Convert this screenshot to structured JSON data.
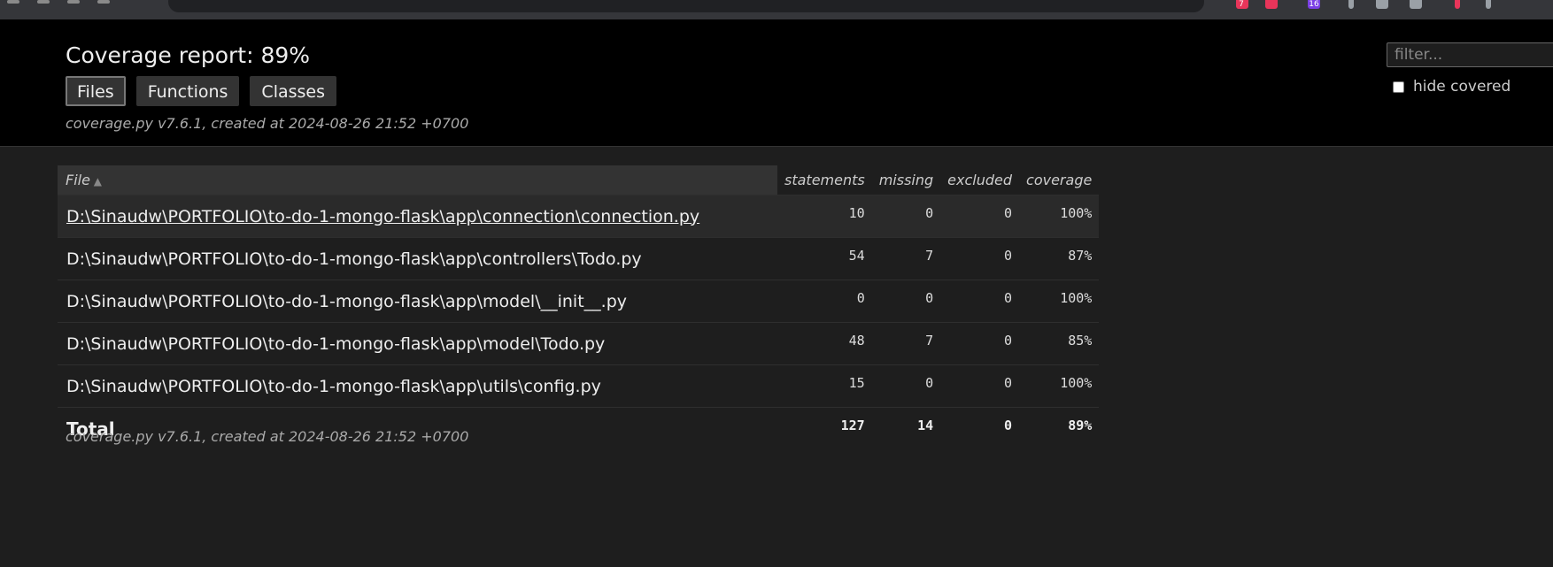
{
  "browser": {
    "extension_badges": [
      "7",
      "16"
    ]
  },
  "header": {
    "title": "Coverage report: 89%",
    "tabs": [
      {
        "label": "Files",
        "active": true
      },
      {
        "label": "Functions",
        "active": false
      },
      {
        "label": "Classes",
        "active": false
      }
    ],
    "created": "coverage.py v7.6.1, created at 2024-08-26 21:52 +0700",
    "filter_placeholder": "filter...",
    "hide_covered_label": "hide covered",
    "hide_covered_checked": false
  },
  "table": {
    "columns": [
      "File",
      "statements",
      "missing",
      "excluded",
      "coverage"
    ],
    "rows": [
      {
        "file": "D:\\Sinaudw\\PORTFOLIO\\to-do-1-mongo-flask\\app\\connection\\connection.py",
        "statements": "10",
        "missing": "0",
        "excluded": "0",
        "coverage": "100%"
      },
      {
        "file": "D:\\Sinaudw\\PORTFOLIO\\to-do-1-mongo-flask\\app\\controllers\\Todo.py",
        "statements": "54",
        "missing": "7",
        "excluded": "0",
        "coverage": "87%"
      },
      {
        "file": "D:\\Sinaudw\\PORTFOLIO\\to-do-1-mongo-flask\\app\\model\\__init__.py",
        "statements": "0",
        "missing": "0",
        "excluded": "0",
        "coverage": "100%"
      },
      {
        "file": "D:\\Sinaudw\\PORTFOLIO\\to-do-1-mongo-flask\\app\\model\\Todo.py",
        "statements": "48",
        "missing": "7",
        "excluded": "0",
        "coverage": "85%"
      },
      {
        "file": "D:\\Sinaudw\\PORTFOLIO\\to-do-1-mongo-flask\\app\\utils\\config.py",
        "statements": "15",
        "missing": "0",
        "excluded": "0",
        "coverage": "100%"
      }
    ],
    "total": {
      "label": "Total",
      "statements": "127",
      "missing": "14",
      "excluded": "0",
      "coverage": "89%"
    }
  },
  "footer": {
    "created": "coverage.py v7.6.1, created at 2024-08-26 21:52 +0700"
  },
  "colors": {
    "header_bg": "#000000",
    "page_bg": "#1e1e1e",
    "text": "#eeeeee"
  }
}
